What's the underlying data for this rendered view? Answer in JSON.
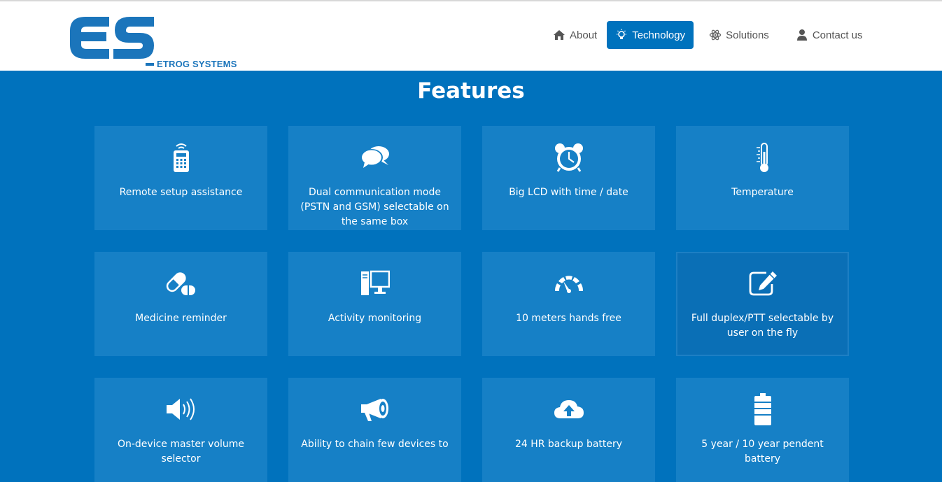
{
  "brand": {
    "initials": "ES",
    "name": "ETROG SYSTEMS",
    "color": "#1b75bb"
  },
  "nav": {
    "items": [
      {
        "label": "About",
        "icon": "home-icon"
      },
      {
        "label": "Technology",
        "icon": "lightbulb-icon",
        "active": true
      },
      {
        "label": "Solutions",
        "icon": "atom-icon"
      },
      {
        "label": "Contact us",
        "icon": "user-icon"
      }
    ]
  },
  "page": {
    "title": "Features"
  },
  "features": [
    {
      "label": "Remote setup assistance",
      "icon": "remote-control-icon"
    },
    {
      "label": "Dual communication mode (PSTN and GSM) selectable on the same box",
      "icon": "chat-bubbles-icon"
    },
    {
      "label": "Big LCD with time / date",
      "icon": "alarm-clock-icon"
    },
    {
      "label": "Temperature",
      "icon": "thermometer-icon"
    },
    {
      "label": "Medicine reminder",
      "icon": "pills-icon"
    },
    {
      "label": "Activity monitoring",
      "icon": "desktop-computer-icon"
    },
    {
      "label": "10 meters hands free",
      "icon": "gauge-icon"
    },
    {
      "label": "Full duplex/PTT selectable by user on the fly",
      "icon": "edit-icon"
    },
    {
      "label": "On-device master volume selector",
      "icon": "speaker-volume-icon"
    },
    {
      "label": "Ability to chain few devices to",
      "icon": "megaphone-icon"
    },
    {
      "label": "24 HR backup battery",
      "icon": "cloud-upload-icon"
    },
    {
      "label": "5 year / 10 year pendent battery",
      "icon": "battery-icon"
    }
  ],
  "colors": {
    "primary": "#0072bd",
    "card": "#1680c6",
    "nav_text": "#555555"
  }
}
